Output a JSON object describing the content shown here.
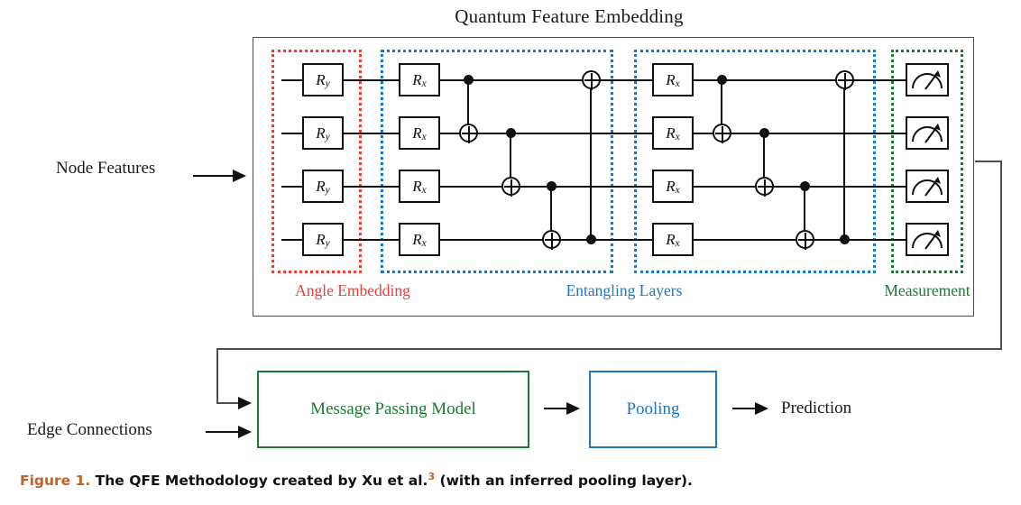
{
  "figure": {
    "title": "Quantum Feature Embedding",
    "caption": {
      "label": "Figure 1.",
      "text_before_ref": "The QFE Methodology created by Xu et al.",
      "reference": "3",
      "text_after_ref": "(with an inferred pooling layer)."
    }
  },
  "colors": {
    "angle_embedding": "#e8413a",
    "entangling_layers": "#1f77c4",
    "measurement": "#1a7a33",
    "message_passing": "#1a7a33",
    "pooling": "#1f77c4",
    "figure_number": "#c0622c",
    "wire": "#111111",
    "outer_box": "#4d4d4d"
  },
  "circuit": {
    "num_qubits": 4,
    "regions": [
      {
        "name": "angle-embedding",
        "label": "Angle Embedding",
        "color": "#e8413a",
        "gate": "Ry"
      },
      {
        "name": "entangling-layer-1",
        "label": "Entangling Layers",
        "color": "#1f77c4",
        "gate": "Rx"
      },
      {
        "name": "entangling-layer-2",
        "label": "",
        "color": "#1f77c4",
        "gate": "Rx"
      },
      {
        "name": "measurement",
        "label": "Measurement",
        "color": "#1a7a33",
        "gate": "meter"
      }
    ],
    "gates": {
      "ry": {
        "main": "R",
        "sub": "y"
      },
      "rx": {
        "main": "R",
        "sub": "x"
      },
      "measure_icon": "measurement-meter-icon"
    },
    "cnot_chain": [
      {
        "control": 0,
        "target": 1
      },
      {
        "control": 1,
        "target": 2
      },
      {
        "control": 2,
        "target": 3
      },
      {
        "control": 3,
        "target": 0
      }
    ]
  },
  "flow": {
    "node_features_label": "Node Features",
    "edge_connections_label": "Edge Connections",
    "message_passing_label": "Message Passing Model",
    "pooling_label": "Pooling",
    "prediction_label": "Prediction"
  }
}
